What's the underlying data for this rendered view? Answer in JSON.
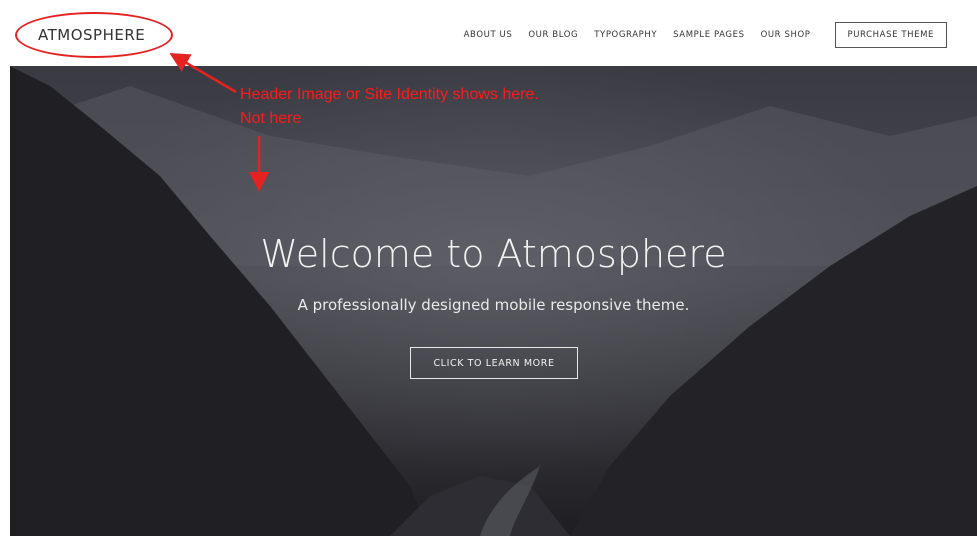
{
  "header": {
    "logo": "ATMOSPHERE",
    "nav": [
      "ABOUT US",
      "OUR BLOG",
      "TYPOGRAPHY",
      "SAMPLE PAGES",
      "OUR SHOP"
    ],
    "purchase_label": "PURCHASE THEME"
  },
  "hero": {
    "title": "Welcome to Atmosphere",
    "subtitle": "A professionally designed mobile responsive theme.",
    "cta_label": "CLICK TO LEARN MORE"
  },
  "annotation": {
    "line1": "Header Image or Site Identity shows here.",
    "line2": "Not here",
    "color": "#ff1a1a"
  }
}
